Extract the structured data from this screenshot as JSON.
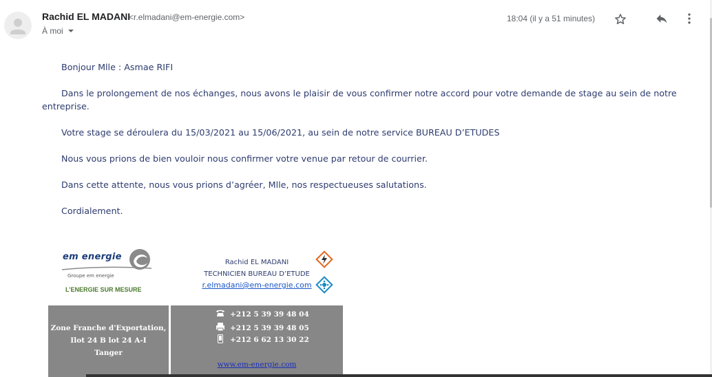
{
  "header": {
    "sender_name": "Rachid EL MADANI",
    "sender_email": "<r.elmadani@em-energie.com>",
    "recipient": "À moi",
    "timestamp": "18:04 (il y a 51 minutes)"
  },
  "icons": {
    "avatar": "person-icon",
    "star": "star-icon",
    "reply": "reply-icon",
    "more": "more-vert-icon",
    "caret": "chevron-down-icon"
  },
  "body": {
    "greeting": "Bonjour Mlle : Asmae RIFI",
    "paragraph_1": "Dans le prolongement de nos échanges, nous avons le plaisir de vous confirmer notre accord pour votre demande de stage au sein de notre entreprise.",
    "paragraph_2": "Votre stage se déroulera du 15/03/2021 au 15/06/2021, au sein de notre service BUREAU D’ETUDES",
    "paragraph_3": "Nous vous prions de bien vouloir nous confirmer votre venue par retour de courrier.",
    "paragraph_4": "Dans cette attente, nous vous prions d’agréer, Mlle, nos respectueuses salutations.",
    "closing": "Cordialement."
  },
  "signature": {
    "logo_text": "em energie",
    "logo_group": "Groupe em energie",
    "logo_tagline": "L’ENERGIE SUR MESURE",
    "name": "Rachid EL MADANI",
    "title": "TECHNICIEN BUREAU D’ETUDE",
    "email": "r.elmadani@em-energie.com",
    "address_line_1": "Zone Franche d'Exportation,",
    "address_line_2": "Ilot 24 B lot 24 A-I",
    "address_line_3": "Tanger",
    "phone": "+212 5 39 39 48 04",
    "fax": "+212 5 39 39 48 05",
    "mobile": "+212 6 62 13 30 22",
    "website": "www.em-energie.com"
  },
  "colors": {
    "body_text": "#2d3b6e",
    "link": "#1a56c8",
    "signature_box": "#878787",
    "logo_blue": "#1c3d7a",
    "tagline_green": "#4a7a2c",
    "icon_orange": "#e5671d",
    "icon_blue": "#1b8bc4"
  }
}
